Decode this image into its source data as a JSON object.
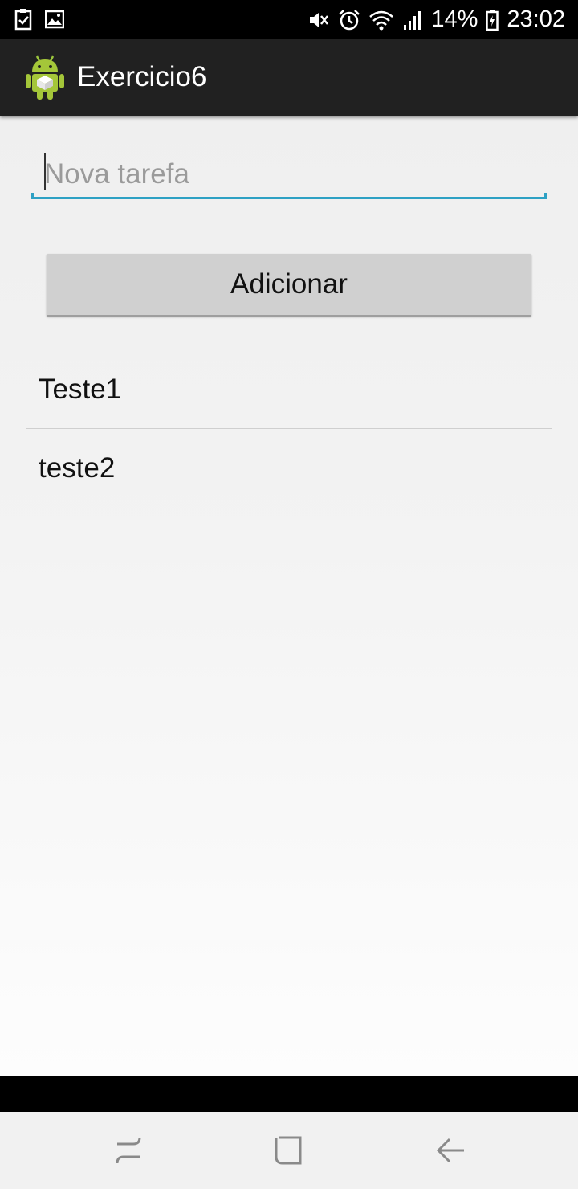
{
  "status_bar": {
    "battery_percent": "14%",
    "time": "23:02",
    "left_icons": [
      "task-check-icon",
      "image-icon"
    ],
    "right_icons": [
      "vibrate-mute-icon",
      "alarm-icon",
      "wifi-icon",
      "signal-icon",
      "battery-charging-icon"
    ]
  },
  "action_bar": {
    "title": "Exercicio6",
    "icon": "android-app-icon"
  },
  "form": {
    "task_placeholder": "Nova tarefa",
    "task_value": "",
    "add_label": "Adicionar"
  },
  "task_list": {
    "items": [
      {
        "label": "Teste1"
      },
      {
        "label": "teste2"
      }
    ]
  },
  "nav_bar": {
    "buttons": [
      "recents-icon",
      "home-icon",
      "back-icon"
    ]
  },
  "colors": {
    "accent": "#2ea1c4",
    "action_bar_bg": "#212121",
    "button_bg": "#d0d0d0"
  }
}
